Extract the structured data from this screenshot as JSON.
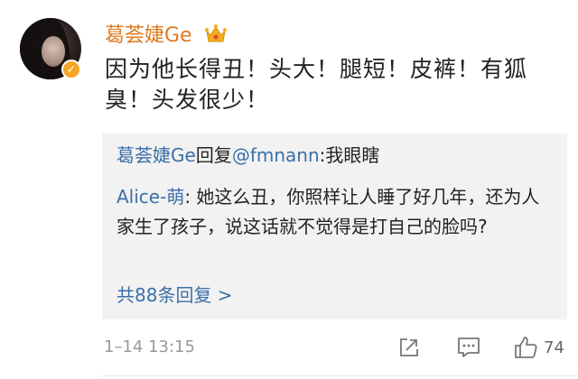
{
  "post": {
    "username": "葛荟婕Ge",
    "text": "因为他长得丑！头大！腿短！皮裤！有狐臭！头发很少！",
    "timestamp": "1–14 13:15"
  },
  "reply_box": {
    "line1": {
      "author": "葛荟婕Ge",
      "verb": "回复",
      "target": "@fmnann",
      "text": ":我眼瞎"
    },
    "line2": {
      "author": "Alice-萌",
      "text": ": 她这么丑，你照样让人睡了好几年，还为人家生了孩子，说这话就不觉得是打自己的脸吗?"
    },
    "more_replies": "共88条回复 >"
  },
  "actions": {
    "like_count": "74"
  },
  "colors": {
    "username": "#e07a1f",
    "link": "#3b6fa8",
    "verified": "#f5a623",
    "reply_bg": "#f2f2f2"
  }
}
